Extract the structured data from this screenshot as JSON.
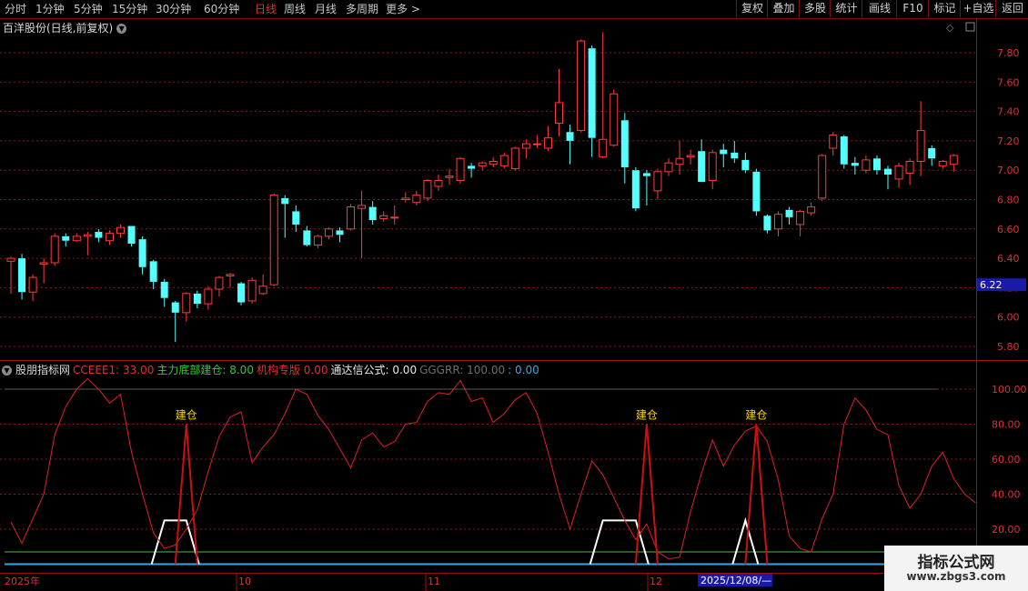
{
  "toolbar": {
    "periods": [
      {
        "label": "分时"
      },
      {
        "label": "1分钟"
      },
      {
        "label": "5分钟"
      },
      {
        "label": "15分钟"
      },
      {
        "label": "30分钟"
      },
      {
        "label": "60分钟"
      },
      {
        "label": "日线",
        "active": true
      },
      {
        "label": "周线"
      },
      {
        "label": "月线"
      },
      {
        "label": "多周期"
      },
      {
        "label": "更多 >"
      }
    ],
    "buttons": [
      {
        "label": "复权"
      },
      {
        "label": "叠加"
      },
      {
        "label": "多股"
      },
      {
        "label": "统计"
      },
      {
        "label": "画线"
      },
      {
        "label": "F10"
      },
      {
        "label": "标记"
      },
      {
        "label": "+自选"
      },
      {
        "label": "返回"
      }
    ]
  },
  "stock": {
    "title": "百洋股份(日线,前复权)",
    "current_price_label": "6.22"
  },
  "indicator": {
    "name": "股朋指标网",
    "items": [
      {
        "text": "CCEEE1: 33.00",
        "color": "#e03030"
      },
      {
        "text": "主力底部建仓: 8.00",
        "color": "#3ac43a"
      },
      {
        "text": "机构专版  0.00",
        "color": "#e03030"
      },
      {
        "text": "通达信公式: 0.00",
        "color": "#e8e8e8"
      },
      {
        "text": "GGGRR: 100.00",
        "color": "#6e6e6e"
      },
      {
        "text": ": 0.00",
        "color": "#37a6e6"
      }
    ],
    "signal_label": "建仓"
  },
  "date_axis": {
    "labels": [
      "2025年",
      "10",
      "11",
      "12"
    ],
    "cursor_date": "2025/12/08/—"
  },
  "watermark": {
    "line1": "指标公式网",
    "line2": "www.zbgs3.com"
  },
  "colors": {
    "up": "#ff3b3b",
    "down": "#54ffff",
    "osc_line": "#e02020",
    "signal": "#cc1010",
    "ref_green": "#3ac43a",
    "ref_blue": "#37a6e6",
    "bg": "#000000"
  },
  "chart_data": [
    {
      "type": "candlestick",
      "yticks": [
        5.8,
        6.0,
        6.2,
        6.4,
        6.6,
        6.8,
        7.0,
        7.2,
        7.4,
        7.6,
        7.8
      ],
      "ylim": [
        5.73,
        7.93
      ],
      "candles": [
        {
          "o": 6.38,
          "c": 6.4,
          "h": 6.41,
          "l": 6.16
        },
        {
          "o": 6.4,
          "c": 6.17,
          "h": 6.43,
          "l": 6.12
        },
        {
          "o": 6.17,
          "c": 6.27,
          "h": 6.29,
          "l": 6.11
        },
        {
          "o": 6.36,
          "c": 6.37,
          "h": 6.4,
          "l": 6.23
        },
        {
          "o": 6.37,
          "c": 6.55,
          "h": 6.57,
          "l": 6.35
        },
        {
          "o": 6.55,
          "c": 6.52,
          "h": 6.57,
          "l": 6.48
        },
        {
          "o": 6.52,
          "c": 6.55,
          "h": 6.57,
          "l": 6.51
        },
        {
          "o": 6.55,
          "c": 6.56,
          "h": 6.58,
          "l": 6.42
        },
        {
          "o": 6.58,
          "c": 6.54,
          "h": 6.6,
          "l": 6.51
        },
        {
          "o": 6.52,
          "c": 6.57,
          "h": 6.59,
          "l": 6.49
        },
        {
          "o": 6.57,
          "c": 6.61,
          "h": 6.63,
          "l": 6.54
        },
        {
          "o": 6.62,
          "c": 6.5,
          "h": 6.62,
          "l": 6.48
        },
        {
          "o": 6.53,
          "c": 6.34,
          "h": 6.55,
          "l": 6.29
        },
        {
          "o": 6.38,
          "c": 6.24,
          "h": 6.39,
          "l": 6.19
        },
        {
          "o": 6.24,
          "c": 6.13,
          "h": 6.26,
          "l": 6.07
        },
        {
          "o": 6.1,
          "c": 6.03,
          "h": 6.11,
          "l": 5.83
        },
        {
          "o": 6.03,
          "c": 6.16,
          "h": 6.17,
          "l": 5.97
        },
        {
          "o": 6.16,
          "c": 6.09,
          "h": 6.18,
          "l": 6.06
        },
        {
          "o": 6.09,
          "c": 6.19,
          "h": 6.21,
          "l": 6.05
        },
        {
          "o": 6.19,
          "c": 6.27,
          "h": 6.28,
          "l": 6.14
        },
        {
          "o": 6.28,
          "c": 6.29,
          "h": 6.3,
          "l": 6.2
        },
        {
          "o": 6.23,
          "c": 6.1,
          "h": 6.24,
          "l": 6.08
        },
        {
          "o": 6.11,
          "c": 6.25,
          "h": 6.27,
          "l": 6.09
        },
        {
          "o": 6.16,
          "c": 6.21,
          "h": 6.29,
          "l": 6.15
        },
        {
          "o": 6.22,
          "c": 6.83,
          "h": 6.84,
          "l": 6.21
        },
        {
          "o": 6.81,
          "c": 6.77,
          "h": 6.83,
          "l": 6.54
        },
        {
          "o": 6.72,
          "c": 6.63,
          "h": 6.76,
          "l": 6.58
        },
        {
          "o": 6.59,
          "c": 6.49,
          "h": 6.62,
          "l": 6.48
        },
        {
          "o": 6.49,
          "c": 6.55,
          "h": 6.56,
          "l": 6.47
        },
        {
          "o": 6.55,
          "c": 6.6,
          "h": 6.61,
          "l": 6.53
        },
        {
          "o": 6.59,
          "c": 6.56,
          "h": 6.61,
          "l": 6.51
        },
        {
          "o": 6.6,
          "c": 6.75,
          "h": 6.77,
          "l": 6.59
        },
        {
          "o": 6.74,
          "c": 6.76,
          "h": 6.86,
          "l": 6.4
        },
        {
          "o": 6.75,
          "c": 6.66,
          "h": 6.79,
          "l": 6.63
        },
        {
          "o": 6.67,
          "c": 6.69,
          "h": 6.72,
          "l": 6.65
        },
        {
          "o": 6.68,
          "c": 6.68,
          "h": 6.76,
          "l": 6.63
        },
        {
          "o": 6.8,
          "c": 6.81,
          "h": 6.85,
          "l": 6.78
        },
        {
          "o": 6.78,
          "c": 6.83,
          "h": 6.86,
          "l": 6.76
        },
        {
          "o": 6.81,
          "c": 6.93,
          "h": 6.94,
          "l": 6.79
        },
        {
          "o": 6.89,
          "c": 6.93,
          "h": 6.97,
          "l": 6.86
        },
        {
          "o": 6.95,
          "c": 6.96,
          "h": 7.01,
          "l": 6.9
        },
        {
          "o": 6.93,
          "c": 7.08,
          "h": 7.09,
          "l": 6.91
        },
        {
          "o": 7.03,
          "c": 7.01,
          "h": 7.05,
          "l": 6.95
        },
        {
          "o": 7.03,
          "c": 7.05,
          "h": 7.06,
          "l": 7.0
        },
        {
          "o": 7.04,
          "c": 7.06,
          "h": 7.09,
          "l": 7.02
        },
        {
          "o": 7.03,
          "c": 7.1,
          "h": 7.12,
          "l": 7.01
        },
        {
          "o": 7.01,
          "c": 7.15,
          "h": 7.16,
          "l": 7.0
        },
        {
          "o": 7.15,
          "c": 7.18,
          "h": 7.21,
          "l": 7.08
        },
        {
          "o": 7.18,
          "c": 7.18,
          "h": 7.24,
          "l": 7.15
        },
        {
          "o": 7.15,
          "c": 7.22,
          "h": 7.3,
          "l": 7.13
        },
        {
          "o": 7.32,
          "c": 7.46,
          "h": 7.69,
          "l": 7.23
        },
        {
          "o": 7.26,
          "c": 7.2,
          "h": 7.31,
          "l": 7.04
        },
        {
          "o": 7.27,
          "c": 7.88,
          "h": 7.89,
          "l": 7.26
        },
        {
          "o": 7.83,
          "c": 7.22,
          "h": 7.85,
          "l": 7.09
        },
        {
          "o": 7.09,
          "c": 7.21,
          "h": 7.94,
          "l": 7.08
        },
        {
          "o": 7.17,
          "c": 7.52,
          "h": 7.55,
          "l": 7.16
        },
        {
          "o": 7.34,
          "c": 7.02,
          "h": 7.39,
          "l": 6.91
        },
        {
          "o": 7.0,
          "c": 6.74,
          "h": 7.02,
          "l": 6.72
        },
        {
          "o": 6.98,
          "c": 6.96,
          "h": 7.0,
          "l": 6.76
        },
        {
          "o": 6.86,
          "c": 6.99,
          "h": 7.01,
          "l": 6.8
        },
        {
          "o": 6.99,
          "c": 7.05,
          "h": 7.08,
          "l": 6.96
        },
        {
          "o": 7.04,
          "c": 7.08,
          "h": 7.2,
          "l": 6.97
        },
        {
          "o": 7.09,
          "c": 7.1,
          "h": 7.14,
          "l": 7.04
        },
        {
          "o": 7.13,
          "c": 6.92,
          "h": 7.21,
          "l": 6.92
        },
        {
          "o": 6.93,
          "c": 7.12,
          "h": 7.14,
          "l": 6.87
        },
        {
          "o": 7.14,
          "c": 7.11,
          "h": 7.18,
          "l": 7.02
        },
        {
          "o": 7.12,
          "c": 7.08,
          "h": 7.2,
          "l": 7.05
        },
        {
          "o": 7.07,
          "c": 7.0,
          "h": 7.12,
          "l": 6.98
        },
        {
          "o": 6.99,
          "c": 6.72,
          "h": 7.01,
          "l": 6.69
        },
        {
          "o": 6.69,
          "c": 6.59,
          "h": 6.7,
          "l": 6.57
        },
        {
          "o": 6.6,
          "c": 6.7,
          "h": 6.72,
          "l": 6.55
        },
        {
          "o": 6.73,
          "c": 6.68,
          "h": 6.75,
          "l": 6.63
        },
        {
          "o": 6.63,
          "c": 6.72,
          "h": 6.73,
          "l": 6.55
        },
        {
          "o": 6.71,
          "c": 6.75,
          "h": 6.78,
          "l": 6.69
        },
        {
          "o": 6.81,
          "c": 7.1,
          "h": 7.11,
          "l": 6.79
        },
        {
          "o": 7.15,
          "c": 7.24,
          "h": 7.26,
          "l": 7.1
        },
        {
          "o": 7.23,
          "c": 7.04,
          "h": 7.24,
          "l": 7.01
        },
        {
          "o": 7.05,
          "c": 7.03,
          "h": 7.09,
          "l": 6.97
        },
        {
          "o": 7.0,
          "c": 7.07,
          "h": 7.1,
          "l": 6.98
        },
        {
          "o": 7.08,
          "c": 7.0,
          "h": 7.1,
          "l": 6.97
        },
        {
          "o": 7.01,
          "c": 6.97,
          "h": 7.03,
          "l": 6.87
        },
        {
          "o": 6.94,
          "c": 7.03,
          "h": 7.05,
          "l": 6.88
        },
        {
          "o": 6.98,
          "c": 7.06,
          "h": 7.08,
          "l": 6.9
        },
        {
          "o": 7.06,
          "c": 7.27,
          "h": 7.47,
          "l": 6.96
        },
        {
          "o": 7.15,
          "c": 7.08,
          "h": 7.17,
          "l": 7.03
        },
        {
          "o": 7.03,
          "c": 7.06,
          "h": 7.07,
          "l": 7.01
        },
        {
          "o": 7.04,
          "c": 7.1,
          "h": 7.11,
          "l": 6.99
        }
      ]
    },
    {
      "type": "line",
      "yticks": [
        20,
        40,
        60,
        80,
        100
      ],
      "ylim": [
        -5,
        120
      ],
      "cceee1": [
        24,
        12,
        26,
        40,
        74,
        90,
        100,
        106,
        100,
        92,
        97,
        64,
        40,
        18,
        9,
        11,
        20,
        31,
        53,
        73,
        84,
        87,
        58,
        67,
        74,
        86,
        100,
        97,
        85,
        77,
        66,
        55,
        71,
        75,
        67,
        70,
        80,
        81,
        93,
        98,
        97,
        105,
        93,
        95,
        81,
        86,
        94,
        98,
        86,
        64,
        40,
        20,
        40,
        59,
        51,
        38,
        25,
        14,
        23,
        7,
        3,
        4,
        30,
        52,
        71,
        56,
        68,
        76,
        79,
        70,
        48,
        16,
        9,
        7,
        26,
        40,
        80,
        95,
        88,
        77,
        74,
        45,
        32,
        40,
        56,
        64,
        49,
        40,
        35
      ],
      "jiancang": [
        0,
        0,
        0,
        0,
        0,
        0,
        0,
        0,
        0,
        0,
        0,
        0,
        0,
        0,
        0,
        0,
        80,
        0,
        0,
        0,
        0,
        0,
        0,
        0,
        0,
        0,
        0,
        0,
        0,
        0,
        0,
        0,
        0,
        0,
        0,
        0,
        0,
        0,
        0,
        0,
        0,
        0,
        0,
        0,
        0,
        0,
        0,
        0,
        0,
        0,
        0,
        0,
        0,
        0,
        0,
        0,
        0,
        0,
        80,
        0,
        0,
        0,
        0,
        0,
        0,
        0,
        0,
        0,
        80,
        0,
        0,
        0,
        0,
        0,
        0,
        0,
        0,
        0,
        0,
        0,
        0,
        0,
        0,
        0,
        0,
        0,
        0,
        0,
        0
      ],
      "white_plateaus": [
        [
          13,
          17,
          25
        ],
        [
          53,
          58,
          25
        ],
        [
          66,
          68,
          25
        ]
      ],
      "green_level": 7,
      "blue_level": 0,
      "gray_level": 100
    }
  ]
}
